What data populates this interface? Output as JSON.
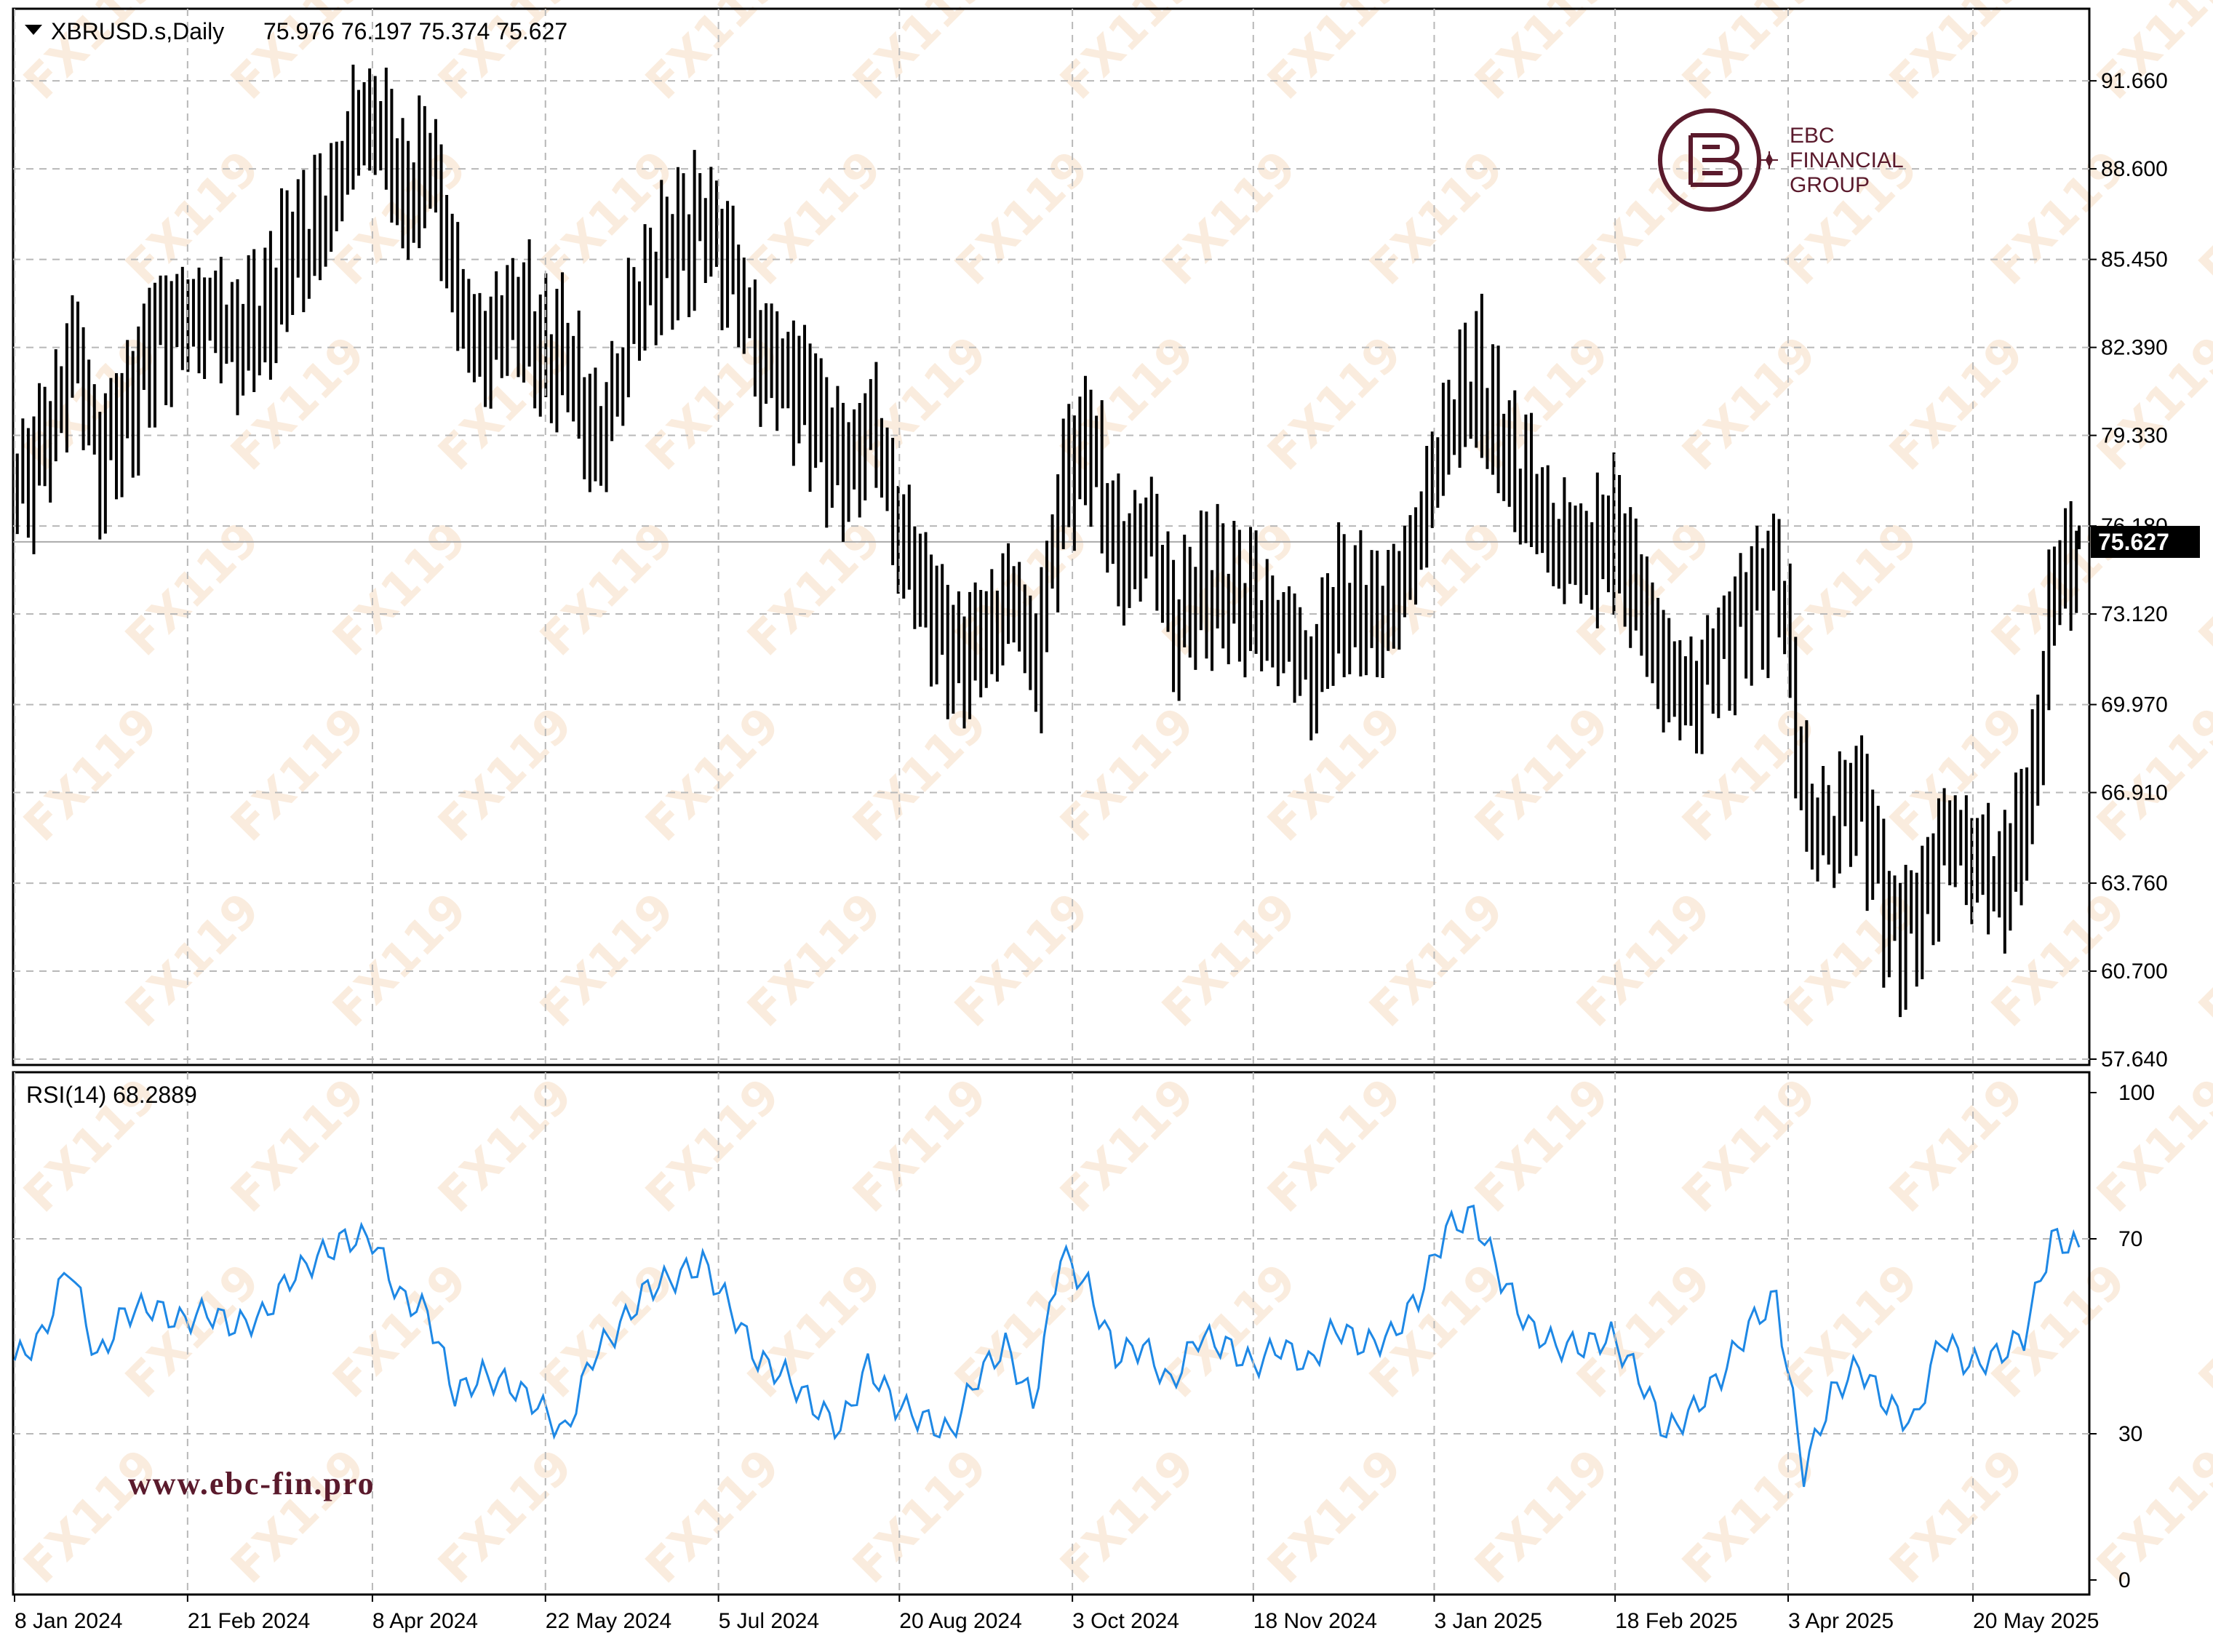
{
  "header": {
    "symbol_info": "XBRUSD.s,Daily",
    "ohlc": "75.976 76.197 75.374 75.627"
  },
  "price_axis": {
    "ticks": [
      "91.660",
      "88.600",
      "85.450",
      "82.390",
      "79.330",
      "76.180",
      "73.120",
      "69.970",
      "66.910",
      "63.760",
      "60.700",
      "57.640"
    ],
    "current_price_label": "75.627"
  },
  "rsi_panel": {
    "label": "RSI(14) 68.2889",
    "ticks": [
      "100",
      "70",
      "30",
      "0"
    ]
  },
  "date_axis": {
    "labels": [
      "8 Jan 2024",
      "21 Feb 2024",
      "8 Apr 2024",
      "22 May 2024",
      "5 Jul 2024",
      "20 Aug 2024",
      "3 Oct 2024",
      "18 Nov 2024",
      "3 Jan 2025",
      "18 Feb 2025",
      "3 Apr 2025",
      "20 May 2025"
    ]
  },
  "branding": {
    "logo_line1": "EBC",
    "logo_line2": "FINANCIAL",
    "logo_line3": "GROUP",
    "website": "www.ebc-fin.pro",
    "watermark": "FX119"
  },
  "colors": {
    "bars": "#000000",
    "rsi_line": "#1e88e5",
    "grid": "#b8b8b8",
    "price_line": "#aaaaaa",
    "brand": "#5a1a2c"
  },
  "chart_data": [
    {
      "type": "ohlc",
      "title": "XBRUSD.s,Daily",
      "ylim": [
        57.64,
        92.7
      ],
      "x": [
        "2024-01-08",
        "2024-01-15",
        "2024-01-22",
        "2024-01-29",
        "2024-02-05",
        "2024-02-12",
        "2024-02-19",
        "2024-02-26",
        "2024-03-04",
        "2024-03-11",
        "2024-03-18",
        "2024-03-25",
        "2024-04-01",
        "2024-04-08",
        "2024-04-15",
        "2024-04-22",
        "2024-04-29",
        "2024-05-06",
        "2024-05-13",
        "2024-05-20",
        "2024-05-27",
        "2024-06-03",
        "2024-06-10",
        "2024-06-17",
        "2024-06-24",
        "2024-07-01",
        "2024-07-08",
        "2024-07-15",
        "2024-07-22",
        "2024-07-29",
        "2024-08-05",
        "2024-08-12",
        "2024-08-19",
        "2024-08-26",
        "2024-09-02",
        "2024-09-09",
        "2024-09-16",
        "2024-09-23",
        "2024-09-30",
        "2024-10-07",
        "2024-10-14",
        "2024-10-21",
        "2024-10-28",
        "2024-11-04",
        "2024-11-11",
        "2024-11-18",
        "2024-11-25",
        "2024-12-02",
        "2024-12-09",
        "2024-12-16",
        "2024-12-23",
        "2024-12-30",
        "2025-01-06",
        "2025-01-13",
        "2025-01-20",
        "2025-01-27",
        "2025-02-03",
        "2025-02-10",
        "2025-02-17",
        "2025-02-24",
        "2025-03-03",
        "2025-03-10",
        "2025-03-17",
        "2025-03-24",
        "2025-03-31",
        "2025-04-07",
        "2025-04-14",
        "2025-04-21",
        "2025-04-28",
        "2025-05-05",
        "2025-05-12",
        "2025-05-19",
        "2025-05-26",
        "2025-06-02",
        "2025-06-09",
        "2025-06-16"
      ],
      "close": [
        77.5,
        78.9,
        82.4,
        78.6,
        80.3,
        82.8,
        83.2,
        83.5,
        82.8,
        83.6,
        86.0,
        86.3,
        89.7,
        90.6,
        87.4,
        88.9,
        83.5,
        82.3,
        84.0,
        82.1,
        81.9,
        78.4,
        82.6,
        85.1,
        85.9,
        86.8,
        84.6,
        82.1,
        81.5,
        79.9,
        77.8,
        79.9,
        76.0,
        73.6,
        71.6,
        72.0,
        73.7,
        71.7,
        78.0,
        79.0,
        74.5,
        76.3,
        72.8,
        74.0,
        73.9,
        73.0,
        72.5,
        71.2,
        73.5,
        72.9,
        73.4,
        76.5,
        80.1,
        81.2,
        78.6,
        76.9,
        75.7,
        75.2,
        75.8,
        73.2,
        70.5,
        70.6,
        72.2,
        73.6,
        74.4,
        65.5,
        66.2,
        66.8,
        61.9,
        62.5,
        65.4,
        64.8,
        63.7,
        66.1,
        74.2,
        75.627
      ]
    },
    {
      "type": "line",
      "title": "RSI(14) 68.2889",
      "ylim": [
        0,
        100
      ],
      "x": [
        "2024-01-08",
        "2024-01-15",
        "2024-01-22",
        "2024-01-29",
        "2024-02-05",
        "2024-02-12",
        "2024-02-19",
        "2024-02-26",
        "2024-03-04",
        "2024-03-11",
        "2024-03-18",
        "2024-03-25",
        "2024-04-01",
        "2024-04-08",
        "2024-04-15",
        "2024-04-22",
        "2024-04-29",
        "2024-05-06",
        "2024-05-13",
        "2024-05-20",
        "2024-05-27",
        "2024-06-03",
        "2024-06-10",
        "2024-06-17",
        "2024-06-24",
        "2024-07-01",
        "2024-07-08",
        "2024-07-15",
        "2024-07-22",
        "2024-07-29",
        "2024-08-05",
        "2024-08-12",
        "2024-08-19",
        "2024-08-26",
        "2024-09-02",
        "2024-09-09",
        "2024-09-16",
        "2024-09-23",
        "2024-09-30",
        "2024-10-07",
        "2024-10-14",
        "2024-10-21",
        "2024-10-28",
        "2024-11-04",
        "2024-11-11",
        "2024-11-18",
        "2024-11-25",
        "2024-12-02",
        "2024-12-09",
        "2024-12-16",
        "2024-12-23",
        "2024-12-30",
        "2025-01-06",
        "2025-01-13",
        "2025-01-20",
        "2025-01-27",
        "2025-02-03",
        "2025-02-10",
        "2025-02-17",
        "2025-02-24",
        "2025-03-03",
        "2025-03-10",
        "2025-03-17",
        "2025-03-24",
        "2025-03-31",
        "2025-04-07",
        "2025-04-14",
        "2025-04-21",
        "2025-04-28",
        "2025-05-05",
        "2025-05-12",
        "2025-05-19",
        "2025-05-26",
        "2025-06-02",
        "2025-06-09",
        "2025-06-16"
      ],
      "values": [
        45,
        50,
        65,
        45,
        55,
        56,
        53,
        55,
        52,
        54,
        62,
        66,
        70,
        70,
        58,
        55,
        38,
        42,
        40,
        36,
        30,
        46,
        52,
        60,
        62,
        65,
        56,
        45,
        42,
        36,
        31,
        44,
        36,
        33,
        30,
        42,
        48,
        36,
        67,
        60,
        46,
        48,
        40,
        50,
        48,
        44,
        48,
        44,
        52,
        48,
        50,
        58,
        72,
        75,
        62,
        52,
        48,
        48,
        50,
        42,
        30,
        35,
        42,
        52,
        58,
        22,
        38,
        44,
        36,
        32,
        50,
        44,
        46,
        50,
        70,
        68.2889
      ]
    }
  ]
}
